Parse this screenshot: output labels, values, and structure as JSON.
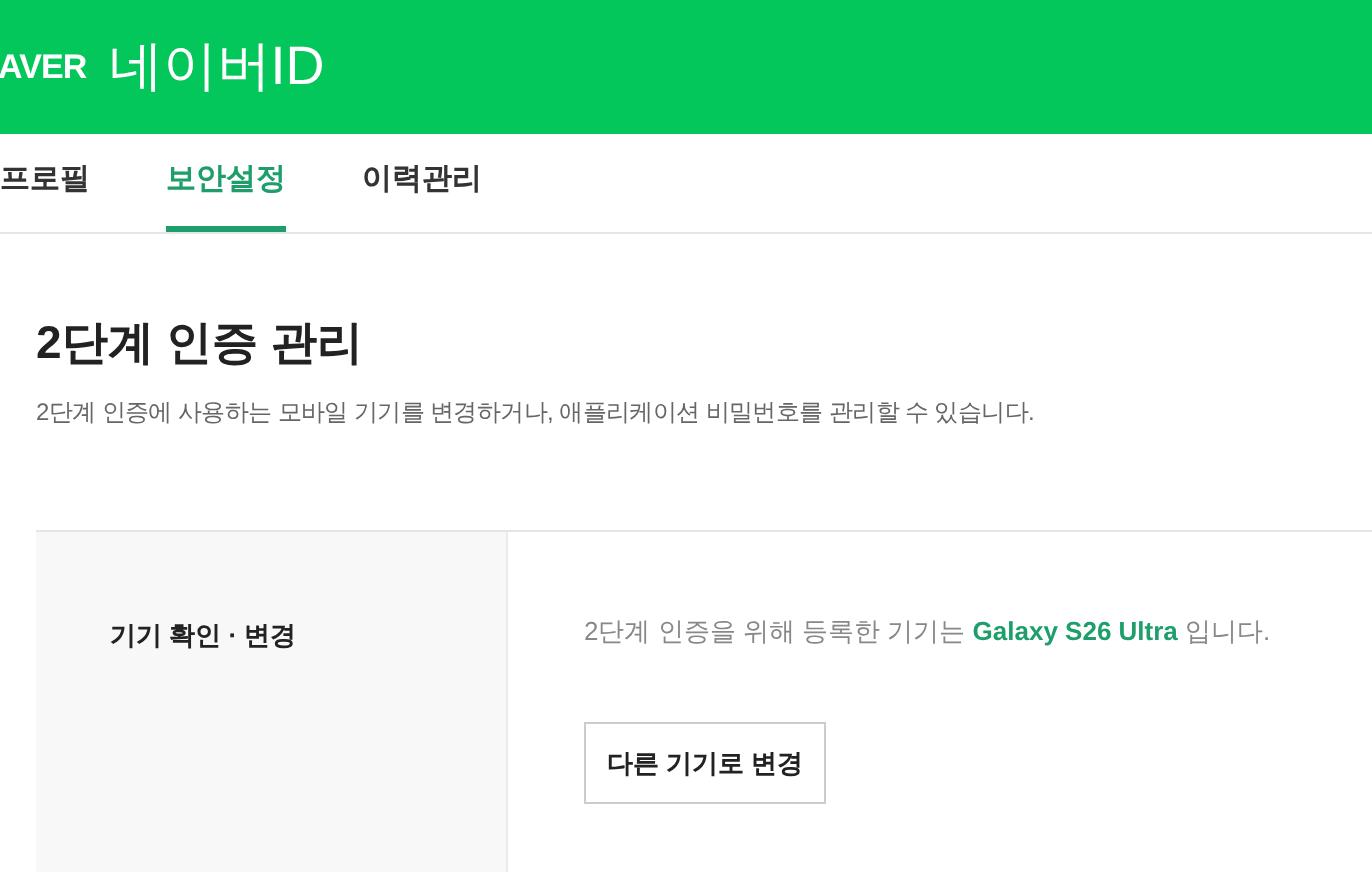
{
  "header": {
    "logo": "AVER",
    "title": "네이버ID"
  },
  "tabs": [
    {
      "label": "프로필",
      "selected": false
    },
    {
      "label": "보안설정",
      "selected": true
    },
    {
      "label": "이력관리",
      "selected": false
    }
  ],
  "section": {
    "title": "2단계 인증 관리",
    "description": "2단계 인증에 사용하는 모바일 기기를 변경하거나, 애플리케이션 비밀번호를 관리할 수 있습니다."
  },
  "rows": [
    {
      "label": "기기 확인 · 변경",
      "text": "2단계 인증을 위해 등록한 기기는 **Galaxy S26 Ultra** 입니다.",
      "button": "다른 기기로 변경"
    }
  ]
}
